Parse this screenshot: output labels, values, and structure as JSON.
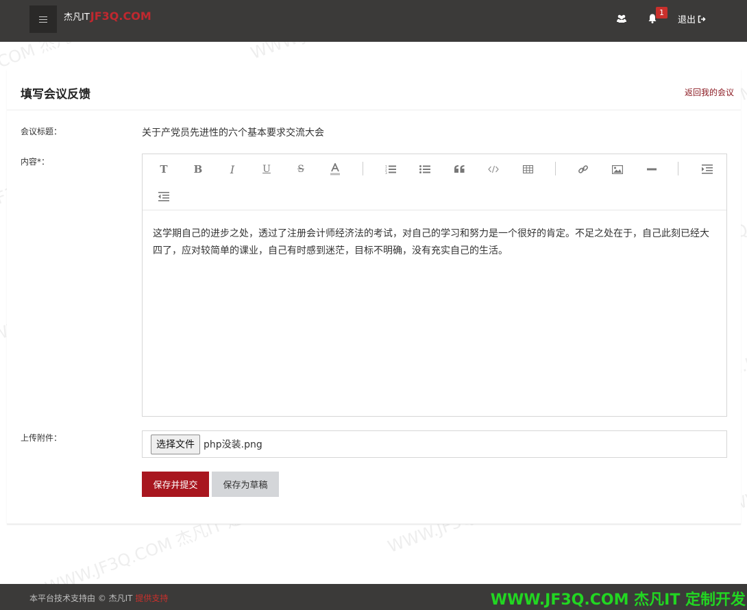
{
  "header": {
    "brand_name": "杰凡IT",
    "brand_domain": "JF3Q.COM",
    "notification_count": "1",
    "logout_label": "退出"
  },
  "page": {
    "title": "填写会议反馈",
    "back_link": "返回我的会议"
  },
  "form": {
    "meeting_title_label": "会议标题：",
    "meeting_title_value": "关于产党员先进性的六个基本要求交流大会",
    "content_label": "内容*：",
    "content_text": "这学期自己的进步之处，透过了注册会计师经济法的考试，对自己的学习和努力是一个很好的肯定。不足之处在于，自己此刻已经大四了，应对较简单的课业，自己有时感到迷茫，目标不明确，没有充实自己的生活。",
    "attachment_label": "上传附件：",
    "file_button_label": "选择文件",
    "file_name": "php没装.png",
    "submit_label": "保存并提交",
    "draft_label": "保存为草稿"
  },
  "toolbar": {
    "buttons": [
      "text-style",
      "bold",
      "italic",
      "underline",
      "strikethrough",
      "font-color",
      "ordered-list",
      "unordered-list",
      "blockquote",
      "code",
      "table",
      "link",
      "image",
      "horizontal-rule",
      "indent",
      "outdent"
    ]
  },
  "footer": {
    "text": "本平台技术支持由 © 杰凡IT ",
    "highlight": "提供支持",
    "watermark": "WWW.JF3Q.COM 杰凡IT  定制开发"
  },
  "watermark_text": "WWW.JF3Q.COM 杰凡IT  定制开发",
  "colors": {
    "header_bg": "#3b3a39",
    "accent": "#a8161f",
    "brand_red": "#c0282f",
    "link": "#8b1a22",
    "footer_watermark": "#22d622"
  }
}
